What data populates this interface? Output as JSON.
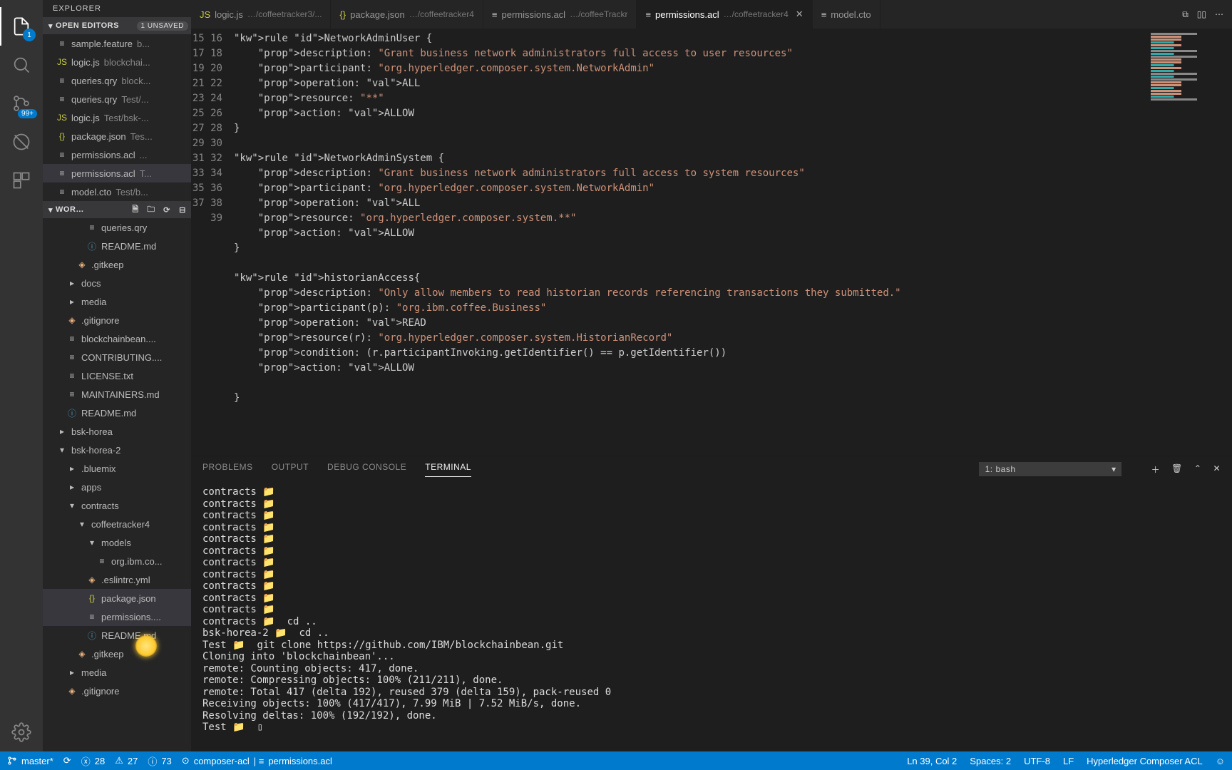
{
  "sidebar_title": "EXPLORER",
  "open_editors": {
    "label": "OPEN EDITORS",
    "badge": "1 UNSAVED",
    "items": [
      {
        "icon": "≡",
        "iconClass": "ic-gen",
        "name": "sample.feature",
        "hint": "b..."
      },
      {
        "icon": "JS",
        "iconClass": "ic-js",
        "name": "logic.js",
        "hint": "blockchai..."
      },
      {
        "icon": "≡",
        "iconClass": "ic-gen",
        "name": "queries.qry",
        "hint": "block..."
      },
      {
        "icon": "≡",
        "iconClass": "ic-gen",
        "name": "queries.qry",
        "hint": "Test/..."
      },
      {
        "icon": "JS",
        "iconClass": "ic-js",
        "name": "logic.js",
        "hint": "Test/bsk-..."
      },
      {
        "icon": "{}",
        "iconClass": "ic-json",
        "name": "package.json",
        "hint": "Tes..."
      },
      {
        "icon": "≡",
        "iconClass": "ic-gen",
        "name": "permissions.acl",
        "hint": "..."
      },
      {
        "icon": "≡",
        "iconClass": "ic-gen",
        "name": "permissions.acl",
        "hint": "T...",
        "selected": true
      },
      {
        "icon": "≡",
        "iconClass": "ic-gen",
        "name": "model.cto",
        "hint": "Test/b..."
      }
    ]
  },
  "workspace": {
    "label": "WOR…",
    "tree": [
      {
        "d": 3,
        "icon": "≡",
        "ic": "ic-gen",
        "name": "queries.qry"
      },
      {
        "d": 3,
        "icon": "ⓘ",
        "ic": "ic-md",
        "name": "README.md"
      },
      {
        "d": 2,
        "icon": "◈",
        "ic": "ic-git",
        "name": ".gitkeep"
      },
      {
        "d": 1,
        "chev": "r",
        "name": "docs"
      },
      {
        "d": 1,
        "chev": "r",
        "name": "media"
      },
      {
        "d": 1,
        "icon": "◈",
        "ic": "ic-git",
        "name": ".gitignore"
      },
      {
        "d": 1,
        "icon": "≡",
        "ic": "ic-gen",
        "name": "blockchainbean...."
      },
      {
        "d": 1,
        "icon": "≡",
        "ic": "ic-gen",
        "name": "CONTRIBUTING...."
      },
      {
        "d": 1,
        "icon": "≡",
        "ic": "ic-gen",
        "name": "LICENSE.txt"
      },
      {
        "d": 1,
        "icon": "≡",
        "ic": "ic-gen",
        "name": "MAINTAINERS.md"
      },
      {
        "d": 1,
        "icon": "ⓘ",
        "ic": "ic-md",
        "name": "README.md",
        "mod": true
      },
      {
        "d": 0,
        "chev": "r",
        "name": "bsk-horea"
      },
      {
        "d": 0,
        "chev": "d",
        "name": "bsk-horea-2"
      },
      {
        "d": 1,
        "chev": "r",
        "name": ".bluemix"
      },
      {
        "d": 1,
        "chev": "r",
        "name": "apps"
      },
      {
        "d": 1,
        "chev": "d",
        "name": "contracts"
      },
      {
        "d": 2,
        "chev": "d",
        "name": "coffeetracker4"
      },
      {
        "d": 3,
        "chev": "d",
        "name": "models"
      },
      {
        "d": 4,
        "icon": "≡",
        "ic": "ic-gen",
        "name": "org.ibm.co..."
      },
      {
        "d": 3,
        "icon": "◈",
        "ic": "ic-git",
        "name": ".eslintrc.yml"
      },
      {
        "d": 3,
        "icon": "{}",
        "ic": "ic-json",
        "name": "package.json",
        "selected2": true
      },
      {
        "d": 3,
        "icon": "≡",
        "ic": "ic-gen",
        "name": "permissions....",
        "selected": true
      },
      {
        "d": 3,
        "icon": "ⓘ",
        "ic": "ic-md",
        "name": "README.md"
      },
      {
        "d": 2,
        "icon": "◈",
        "ic": "ic-git",
        "name": ".gitkeep"
      },
      {
        "d": 1,
        "chev": "r",
        "name": "media"
      },
      {
        "d": 1,
        "icon": "◈",
        "ic": "ic-git",
        "name": ".gitignore"
      }
    ]
  },
  "tabs": [
    {
      "icon": "JS",
      "ic": "ic-js",
      "name": "logic.js",
      "path": "…/coffeetracker3/..."
    },
    {
      "icon": "{}",
      "ic": "ic-json",
      "name": "package.json",
      "path": "…/coffeetracker4"
    },
    {
      "icon": "≡",
      "ic": "ic-gen",
      "name": "permissions.acl",
      "path": "…/coffeeTrackr"
    },
    {
      "icon": "≡",
      "ic": "ic-gen",
      "name": "permissions.acl",
      "path": "…/coffeetracker4",
      "active": true,
      "close": true
    },
    {
      "icon": "≡",
      "ic": "ic-gen",
      "name": "model.cto",
      "path": ""
    }
  ],
  "code": {
    "start": 15,
    "lines": [
      "rule NetworkAdminUser {",
      "    description: \"Grant business network administrators full access to user resources\"",
      "    participant: \"org.hyperledger.composer.system.NetworkAdmin\"",
      "    operation: ALL",
      "    resource: \"**\"",
      "    action: ALLOW",
      "}",
      "",
      "rule NetworkAdminSystem {",
      "    description: \"Grant business network administrators full access to system resources\"",
      "    participant: \"org.hyperledger.composer.system.NetworkAdmin\"",
      "    operation: ALL",
      "    resource: \"org.hyperledger.composer.system.**\"",
      "    action: ALLOW",
      "}",
      "",
      "rule historianAccess{",
      "    description: \"Only allow members to read historian records referencing transactions they submitted.\"",
      "    participant(p): \"org.ibm.coffee.Business\"",
      "    operation: READ",
      "    resource(r): \"org.hyperledger.composer.system.HistorianRecord\"",
      "    condition: (r.participantInvoking.getIdentifier() == p.getIdentifier())",
      "    action: ALLOW",
      "",
      "}"
    ]
  },
  "panel": {
    "tabs": [
      "PROBLEMS",
      "OUTPUT",
      "DEBUG CONSOLE",
      "TERMINAL"
    ],
    "active": 3,
    "term_select": "1: bash",
    "terminal_lines": [
      "contracts 📁 ",
      "contracts 📁 ",
      "contracts 📁 ",
      "contracts 📁 ",
      "contracts 📁 ",
      "contracts 📁 ",
      "contracts 📁 ",
      "contracts 📁 ",
      "contracts 📁 ",
      "contracts 📁 ",
      "contracts 📁 ",
      "contracts 📁  cd ..",
      "bsk-horea-2 📁  cd ..",
      "Test 📁  git clone https://github.com/IBM/blockchainbean.git",
      "Cloning into 'blockchainbean'...",
      "remote: Counting objects: 417, done.",
      "remote: Compressing objects: 100% (211/211), done.",
      "remote: Total 417 (delta 192), reused 379 (delta 159), pack-reused 0",
      "Receiving objects: 100% (417/417), 7.99 MiB | 7.52 MiB/s, done.",
      "Resolving deltas: 100% (192/192), done.",
      "Test 📁  ▯"
    ]
  },
  "status": {
    "branch": "master*",
    "errors": "28",
    "warnings": "27",
    "info": "73",
    "lang_server": "composer-acl",
    "file": "permissions.acl",
    "cursor": "Ln 39, Col 2",
    "spaces": "Spaces: 2",
    "encoding": "UTF-8",
    "eol": "LF",
    "mode": "Hyperledger Composer ACL"
  },
  "badges": {
    "scm": "99+",
    "files": "1"
  }
}
